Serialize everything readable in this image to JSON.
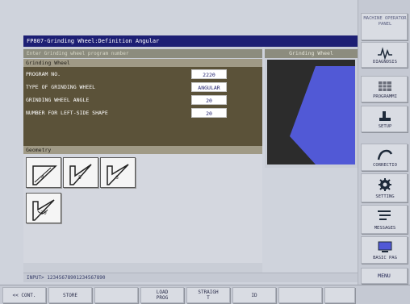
{
  "window": {
    "title": "FP807-Grinding Wheel:Definition Angular"
  },
  "prompt": "Enter Grinding wheel program number",
  "sections": {
    "grinding_wheel": "Grinding Wheel",
    "geometry": "Geometry"
  },
  "params": [
    {
      "label": "PROGRAM NO.",
      "value": "2220"
    },
    {
      "label": "TYPE OF GRINDING WHEEL",
      "value": "ANGULAR"
    },
    {
      "label": "GRINDING WHEEL ANGLE",
      "value": "20"
    },
    {
      "label": "NUMBER FOR LEFT-SIDE SHAPE",
      "value": "20"
    }
  ],
  "geometry_shapes": [
    "4",
    "5",
    "6",
    "30"
  ],
  "wheel_preview": {
    "label": "Grinding Wheel",
    "background": "#2c2c2c",
    "shape_color": "#5159d6"
  },
  "input_line": "INPUT> 12345678901234567890",
  "side_menu": [
    {
      "label": "MACHINE OPERATOR PANEL",
      "icon": "machine-operator-panel-icon"
    },
    {
      "label": "DIAGNOSIS",
      "icon": "waveform-icon"
    },
    {
      "label": "PROGRAMMI",
      "icon": "program-grid-icon"
    },
    {
      "label": "SETUP",
      "icon": "setup-tool-icon"
    },
    {
      "label": "CORRECTIO",
      "icon": "correction-curve-icon"
    },
    {
      "label": "SETTING",
      "icon": "gear-icon"
    },
    {
      "label": "MESSAGES",
      "icon": "message-list-icon"
    },
    {
      "label": "BASIC PAG",
      "icon": "monitor-icon"
    }
  ],
  "menu_button": "MENU",
  "softkeys": [
    "<< CONT.",
    "STORE",
    "",
    "LOAD\nPROG",
    "STRAIGH\nT",
    "ID",
    "",
    ""
  ],
  "colors": {
    "title_bar": "#1d1f74",
    "params_background": "#5b5239",
    "prompt_bar": "#8c8c7e",
    "accent_blue": "#5159d6"
  }
}
